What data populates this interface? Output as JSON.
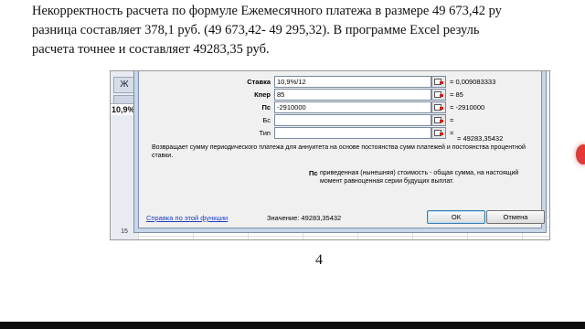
{
  "document": {
    "line1": "Некорректность расчета по формуле Ежемесячного платежа в размере 49 673,42 ру",
    "line2": "разница составляет 378,1 руб. (49 673,42- 49 295,32). В программе Excel резуль",
    "line3": "расчета точнее и составляет 49283,35 руб.",
    "page_number": "4"
  },
  "excel": {
    "ribbon_button": "Ж",
    "cell_value": "10,9%",
    "row_number": "15"
  },
  "dialog": {
    "args": [
      {
        "label": "Ставка",
        "value": "10,9%/12",
        "result": "= 0,009083333",
        "bold": true
      },
      {
        "label": "Кпер",
        "value": "85",
        "result": "= 85",
        "bold": true
      },
      {
        "label": "Пс",
        "value": "-2910000",
        "result": "= -2910000",
        "bold": true
      },
      {
        "label": "Бс",
        "value": "",
        "result": "=",
        "bold": false
      },
      {
        "label": "Тип",
        "value": "",
        "result": "=",
        "bold": false
      }
    ],
    "total": "= 49283,35432",
    "description": "Возвращает сумму периодического платежа для аннуитета на основе постоянства сумм платежей и постоянства процентной ставки.",
    "pc_label": "Пс",
    "pc_description": "приведенная (нынешняя) стоимость - общая сумма, на настоящий момент равноценная серии будущих выплат.",
    "help_link": "Справка по этой функции",
    "value_line": "Значение: 49283,35432",
    "ok_label": "ОК",
    "cancel_label": "Отмена"
  },
  "colors": {
    "link": "#1d3fbf",
    "dialog_frame": "#c8d6ea",
    "indicator": "#e53935"
  }
}
